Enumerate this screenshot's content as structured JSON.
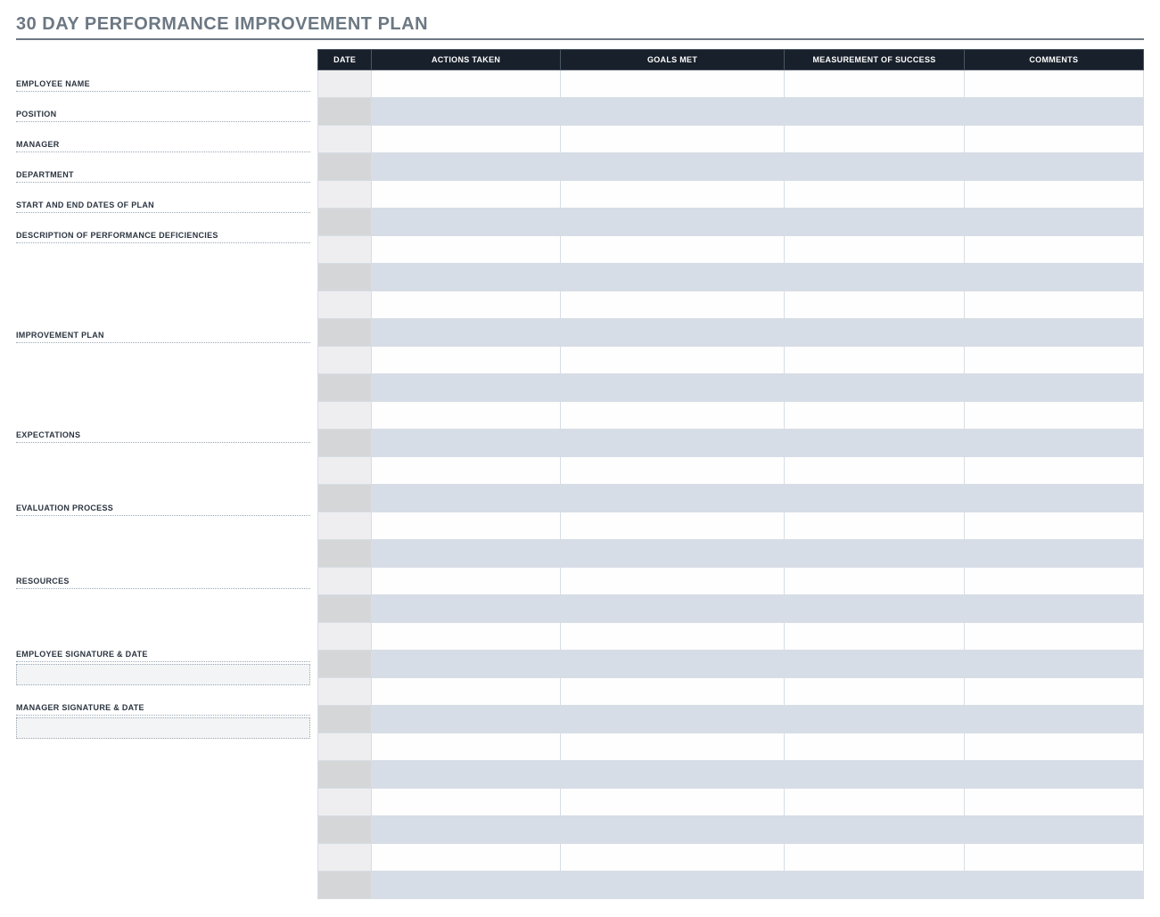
{
  "title": "30 DAY PERFORMANCE IMPROVEMENT PLAN",
  "fields": {
    "employee_name": "EMPLOYEE NAME",
    "position": "POSITION",
    "manager": "MANAGER",
    "department": "DEPARTMENT",
    "dates": "START AND END DATES OF PLAN",
    "deficiencies": "DESCRIPTION OF PERFORMANCE DEFICIENCIES",
    "improvement_plan": "IMPROVEMENT PLAN",
    "expectations": "EXPECTATIONS",
    "evaluation": "EVALUATION PROCESS",
    "resources": "RESOURCES",
    "emp_sig": "EMPLOYEE SIGNATURE & DATE",
    "mgr_sig": "MANAGER SIGNATURE & DATE"
  },
  "table": {
    "headers": {
      "date": "DATE",
      "actions": "ACTIONS TAKEN",
      "goals": "GOALS MET",
      "measurement": "MEASUREMENT OF SUCCESS",
      "comments": "COMMENTS"
    },
    "rowCount": 30
  }
}
